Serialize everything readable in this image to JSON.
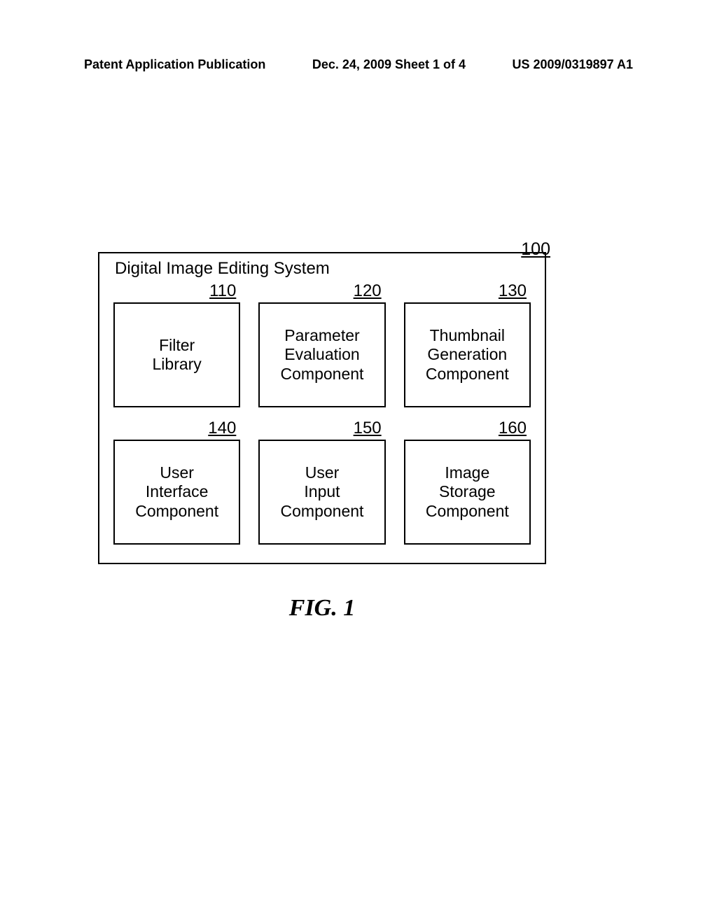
{
  "header": {
    "left": "Patent Application Publication",
    "mid": "Dec. 24, 2009  Sheet 1 of 4",
    "right": "US 2009/0319897 A1"
  },
  "diagram": {
    "ref100": "100",
    "title": "Digital Image Editing System",
    "boxes": [
      {
        "ref": "110",
        "label": "Filter\nLibrary"
      },
      {
        "ref": "120",
        "label": "Parameter\nEvaluation\nComponent"
      },
      {
        "ref": "130",
        "label": "Thumbnail\nGeneration\nComponent"
      },
      {
        "ref": "140",
        "label": "User\nInterface\nComponent"
      },
      {
        "ref": "150",
        "label": "User\nInput\nComponent"
      },
      {
        "ref": "160",
        "label": "Image\nStorage\nComponent"
      }
    ],
    "caption": "FIG. 1"
  }
}
